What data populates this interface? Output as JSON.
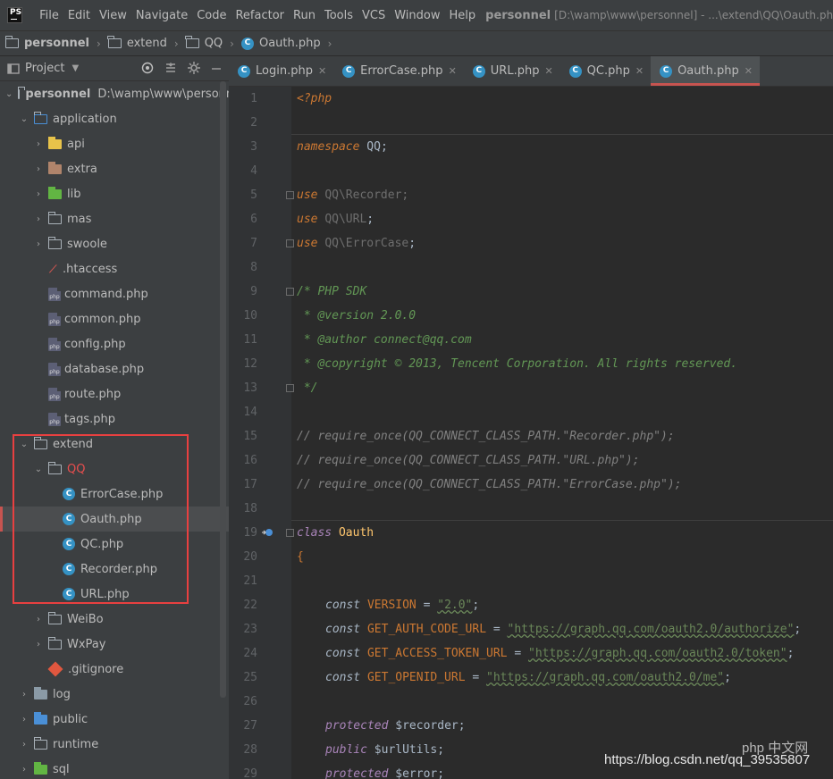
{
  "menubar": {
    "logo": "PS",
    "items": [
      "File",
      "Edit",
      "View",
      "Navigate",
      "Code",
      "Refactor",
      "Run",
      "Tools",
      "VCS",
      "Window",
      "Help"
    ],
    "project_name": "personnel",
    "title_path": "[D:\\wamp\\www\\personnel] - ...\\extend\\QQ\\Oauth.php - Ph"
  },
  "breadcrumb": {
    "items": [
      "personnel",
      "extend",
      "QQ",
      "Oauth.php"
    ]
  },
  "project_panel": {
    "title": "Project",
    "root_label": "personnel",
    "root_path": "D:\\wamp\\www\\personnel",
    "tree": [
      {
        "label": "application"
      },
      {
        "label": "api"
      },
      {
        "label": "extra"
      },
      {
        "label": "lib"
      },
      {
        "label": "mas"
      },
      {
        "label": "swoole"
      },
      {
        "label": ".htaccess"
      },
      {
        "label": "command.php"
      },
      {
        "label": "common.php"
      },
      {
        "label": "config.php"
      },
      {
        "label": "database.php"
      },
      {
        "label": "route.php"
      },
      {
        "label": "tags.php"
      },
      {
        "label": "extend"
      },
      {
        "label": "QQ"
      },
      {
        "label": "ErrorCase.php"
      },
      {
        "label": "Oauth.php"
      },
      {
        "label": "QC.php"
      },
      {
        "label": "Recorder.php"
      },
      {
        "label": "URL.php"
      },
      {
        "label": "WeiBo"
      },
      {
        "label": "WxPay"
      },
      {
        "label": ".gitignore"
      },
      {
        "label": "log"
      },
      {
        "label": "public"
      },
      {
        "label": "runtime"
      },
      {
        "label": "sql"
      }
    ]
  },
  "tabs": [
    {
      "label": "Login.php"
    },
    {
      "label": "ErrorCase.php"
    },
    {
      "label": "URL.php"
    },
    {
      "label": "QC.php"
    },
    {
      "label": "Oauth.php"
    }
  ],
  "active_tab": "Oauth.php",
  "line_numbers": [
    "1",
    "2",
    "3",
    "4",
    "5",
    "6",
    "7",
    "8",
    "9",
    "10",
    "11",
    "12",
    "13",
    "14",
    "15",
    "16",
    "17",
    "18",
    "19",
    "20",
    "21",
    "22",
    "23",
    "24",
    "25",
    "26",
    "27",
    "28",
    "29"
  ],
  "code": {
    "l1": "<?php",
    "l3_kw": "namespace",
    "l3_ns": "QQ",
    "l3_end": ";",
    "l5_kw": "use",
    "l5_ns": "QQ\\Recorder",
    "l6_kw": "use",
    "l6_ns": "QQ\\URL",
    "l7_kw": "use",
    "l7_ns": "QQ\\ErrorCase",
    "semi": ";",
    "l9": "/* PHP SDK",
    "l10": " * @version 2.0.0",
    "l11": " * @author connect@qq.com",
    "l12": " * @copyright © 2013, Tencent Corporation. All rights reserved.",
    "l13": " */",
    "l15": "// require_once(QQ_CONNECT_CLASS_PATH.\"Recorder.php\");",
    "l16": "// require_once(QQ_CONNECT_CLASS_PATH.\"URL.php\");",
    "l17": "// require_once(QQ_CONNECT_CLASS_PATH.\"ErrorCase.php\");",
    "l19_kw": "class",
    "l19_name": "Oauth",
    "l20": "{",
    "const_kw": "const",
    "l22_name": "VERSION",
    "l22_val": "\"2.0\"",
    "l23_name": "GET_AUTH_CODE_URL",
    "l23_val": "\"https://graph.qq.com/oauth2.0/authorize\"",
    "l24_name": "GET_ACCESS_TOKEN_URL",
    "l24_val": "\"https://graph.qq.com/oauth2.0/token\"",
    "l25_name": "GET_OPENID_URL",
    "l25_val": "\"https://graph.qq.com/oauth2.0/me\"",
    "eq": " = ",
    "l27_kw": "protected",
    "l27_var": "$recorder",
    "l28_kw": "public",
    "l28_var": "$urlUtils",
    "l29_kw": "protected",
    "l29_var": "$error"
  },
  "watermark": {
    "text": "https://blog.csdn.net/qq_39535807",
    "logo": "php 中文网"
  },
  "colors": {
    "accent_red": "#e84040",
    "selection_bar": "#c75450",
    "keyword": "#cc7832",
    "string": "#6a8759",
    "doc_comment": "#629755",
    "class_name": "#ffc66d"
  }
}
